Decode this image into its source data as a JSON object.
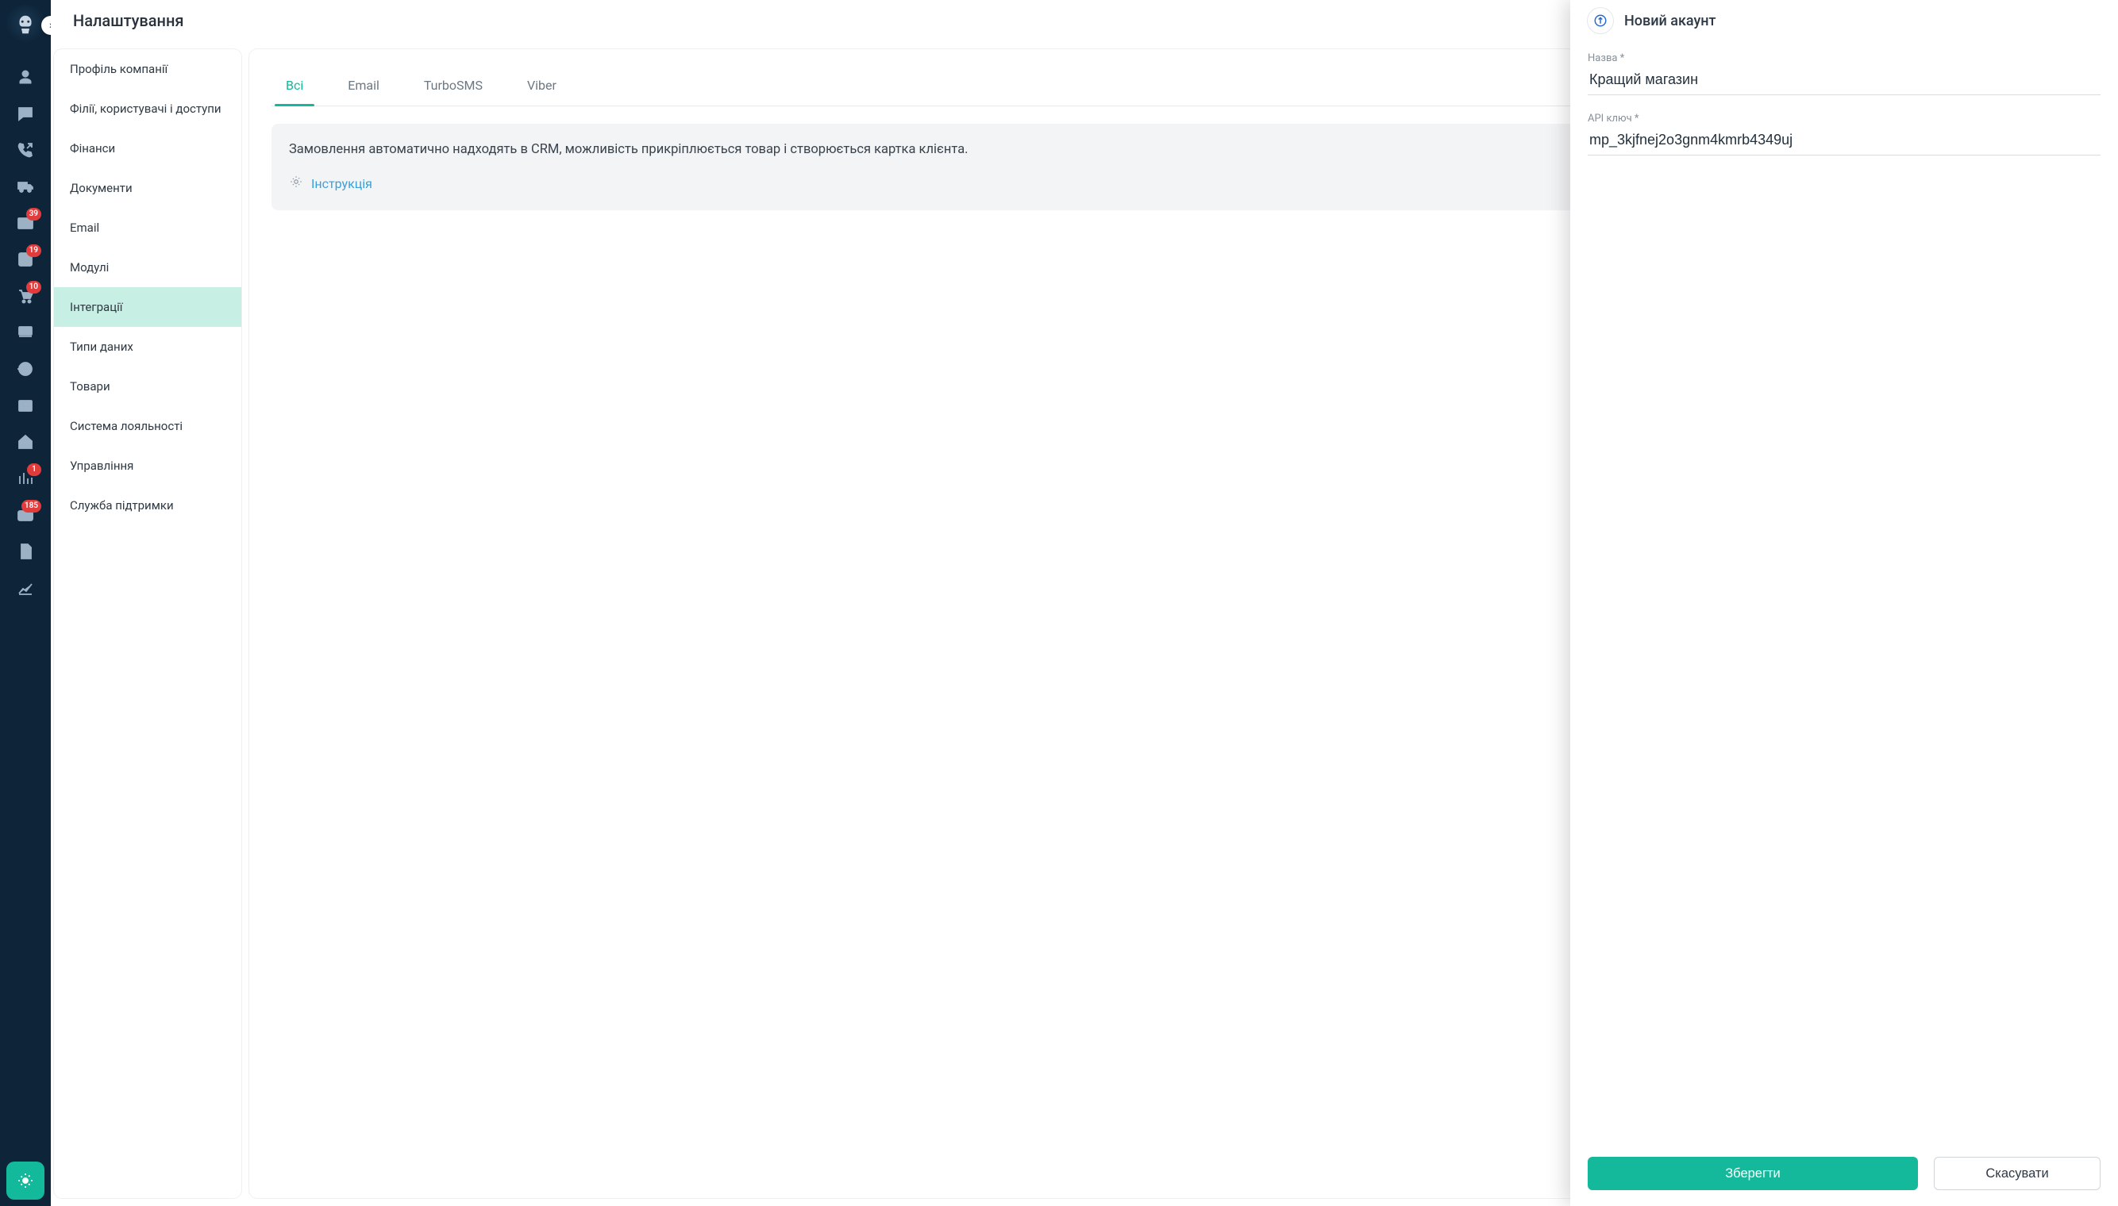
{
  "rail": {
    "badges": {
      "mail": "39",
      "edit": "19",
      "cart": "10",
      "stats": "1",
      "wallet": "185"
    }
  },
  "settings": {
    "title": "Налаштування",
    "nav": [
      "Профіль компанії",
      "Філії, користувачі і доступи",
      "Фінанси",
      "Документи",
      "Email",
      "Модулі",
      "Інтеграції",
      "Типи даних",
      "Товари",
      "Система лояльності",
      "Управління",
      "Служба підтримки"
    ],
    "tabs": [
      "Всі",
      "Email",
      "TurboSMS",
      "Viber"
    ],
    "banner": "Замовлення автоматично надходять в CRM, можливість прикріплюється товар і створюється картка клієнта.",
    "instruction": "Інструкція"
  },
  "drawer": {
    "title": "Новий акаунт",
    "name_label": "Назва *",
    "name_value": "Кращий магазин",
    "api_label": "API ключ *",
    "api_value": "mp_3kjfnej2o3gnm4kmrb4349uj",
    "save": "Зберегти",
    "cancel": "Скасувати"
  }
}
